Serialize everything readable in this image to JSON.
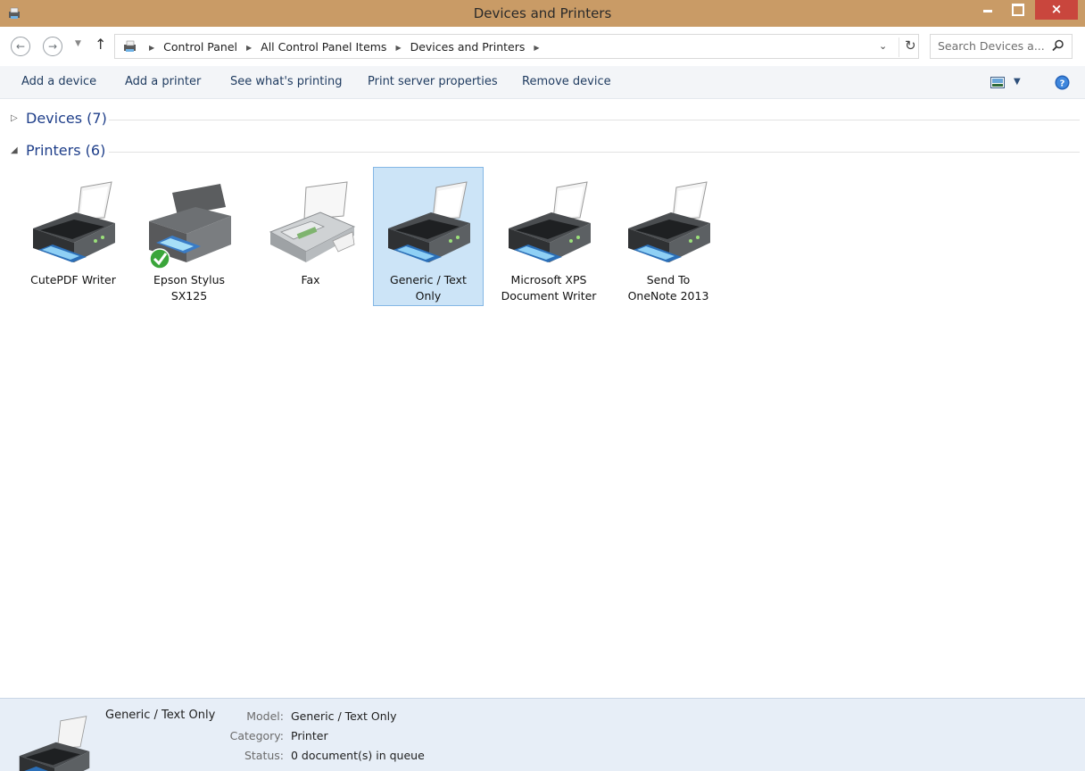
{
  "window": {
    "title": "Devices and Printers",
    "close_label": "×"
  },
  "address": {
    "breadcrumbs": [
      "Control Panel",
      "All Control Panel Items",
      "Devices and Printers"
    ],
    "search_placeholder": "Search Devices a..."
  },
  "commands": {
    "add_device": "Add a device",
    "add_printer": "Add a printer",
    "whats_printing": "See what's printing",
    "print_server": "Print server properties",
    "remove_device": "Remove device"
  },
  "groups": {
    "devices": {
      "label": "Devices (7)",
      "expanded": false
    },
    "printers": {
      "label": "Printers (6)",
      "expanded": true
    }
  },
  "printers": [
    {
      "line1": "CutePDF Writer",
      "line2": "",
      "icon": "printer-icon"
    },
    {
      "line1": "Epson Stylus",
      "line2": "SX125",
      "icon": "default-printer-icon",
      "default": true
    },
    {
      "line1": "Fax",
      "line2": "",
      "icon": "fax-icon"
    },
    {
      "line1": "Generic / Text",
      "line2": "Only",
      "icon": "printer-icon",
      "selected": true
    },
    {
      "line1": "Microsoft XPS",
      "line2": "Document Writer",
      "icon": "printer-icon"
    },
    {
      "line1": "Send To",
      "line2": "OneNote 2013",
      "icon": "printer-icon"
    }
  ],
  "details": {
    "name": "Generic / Text Only",
    "model_label": "Model:",
    "model_value": "Generic / Text Only",
    "category_label": "Category:",
    "category_value": "Printer",
    "status_label": "Status:",
    "status_value": "0 document(s) in queue"
  },
  "colors": {
    "titlebar": "#c99b66",
    "close_button": "#c9463d",
    "selection": "#cce4f7",
    "group_header": "#1f3f8a",
    "details_pane": "#e7eef7"
  }
}
